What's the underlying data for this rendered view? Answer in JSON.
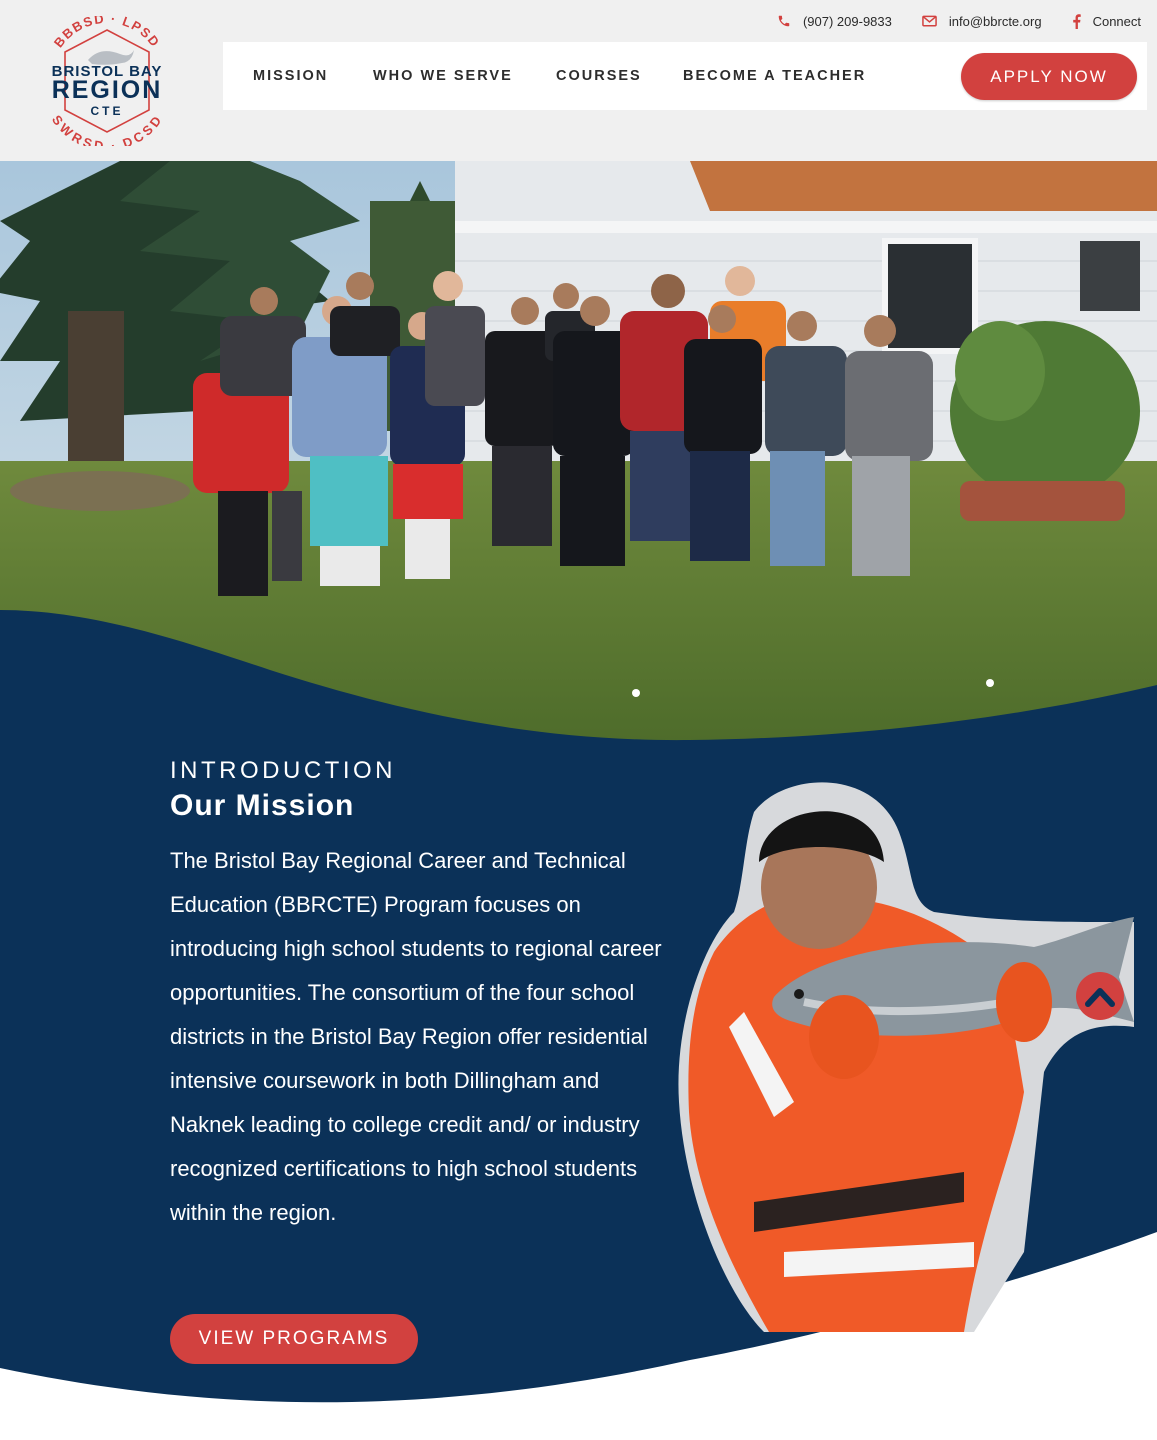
{
  "header": {
    "logo": {
      "top_arc": "BBBSD · LPSD",
      "line1": "BRISTOL BAY",
      "line2": "REGION",
      "line3": "CTE",
      "bottom_arc": "SWRSD · DCSD"
    },
    "contact": {
      "phone": "(907) 209-9833",
      "email": "info@bbrcte.org",
      "social": "Connect"
    },
    "nav": {
      "items": [
        {
          "label": "MISSION"
        },
        {
          "label": "WHO WE SERVE"
        },
        {
          "label": "COURSES"
        },
        {
          "label": "BECOME A TEACHER"
        }
      ],
      "cta": "APPLY NOW"
    }
  },
  "hero": {
    "image": "Group of students standing on grass in front of a white house"
  },
  "mission": {
    "eyebrow": "INTRODUCTION",
    "title": "Our Mission",
    "body": "The Bristol Bay Regional Career and Technical Education (BBRCTE) Program focuses on introducing high school students to regional career opportunities. The consortium of the four school districts in the Bristol Bay Region offer residential intensive coursework in both Dillingham and Naknek leading to college credit and/ or industry recognized certifications to high school students within the region.",
    "button": "VIEW PROGRAMS",
    "image": "Student in orange rain gear holding a salmon"
  },
  "colors": {
    "navy": "#0b3158",
    "accent_red": "#d2413f",
    "header_bg": "#f0f0f0"
  },
  "icons": [
    "phone-icon",
    "envelope-icon",
    "facebook-icon",
    "chevron-up-icon"
  ]
}
